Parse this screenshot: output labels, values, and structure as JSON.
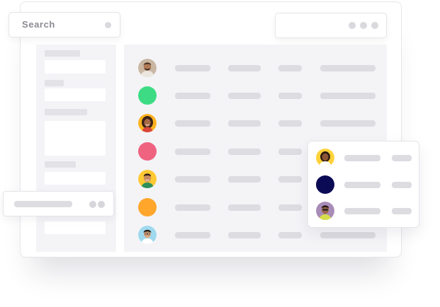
{
  "search": {
    "label": "Search",
    "dot_icon": "circle-icon"
  },
  "header_actions": {
    "icon": "more-dots-icon"
  },
  "colors": {
    "panel_bg": "#f4f4f7",
    "placeholder_bar": "#dcdce1",
    "green_avatar": "#3ddc84",
    "pink_avatar": "#ef6380",
    "orange_avatar": "#ffa62b",
    "navy_avatar": "#0a0a55"
  },
  "table": {
    "rows": [
      {
        "avatar": "person-avatar-bearded-man",
        "type": "photo"
      },
      {
        "avatar": "green-avatar",
        "type": "color"
      },
      {
        "avatar": "person-avatar-woman-curly-hair",
        "type": "photo"
      },
      {
        "avatar": "pink-avatar",
        "type": "color"
      },
      {
        "avatar": "person-avatar-man-yellow-bg",
        "type": "photo"
      },
      {
        "avatar": "orange-avatar",
        "type": "color"
      },
      {
        "avatar": "person-avatar-man-blue-bg",
        "type": "photo"
      }
    ]
  },
  "popup": {
    "rows": [
      {
        "avatar": "person-avatar-woman-yellow-bg",
        "type": "photo"
      },
      {
        "avatar": "navy-avatar",
        "type": "color"
      },
      {
        "avatar": "person-avatar-man-purple-bg",
        "type": "photo"
      }
    ]
  }
}
